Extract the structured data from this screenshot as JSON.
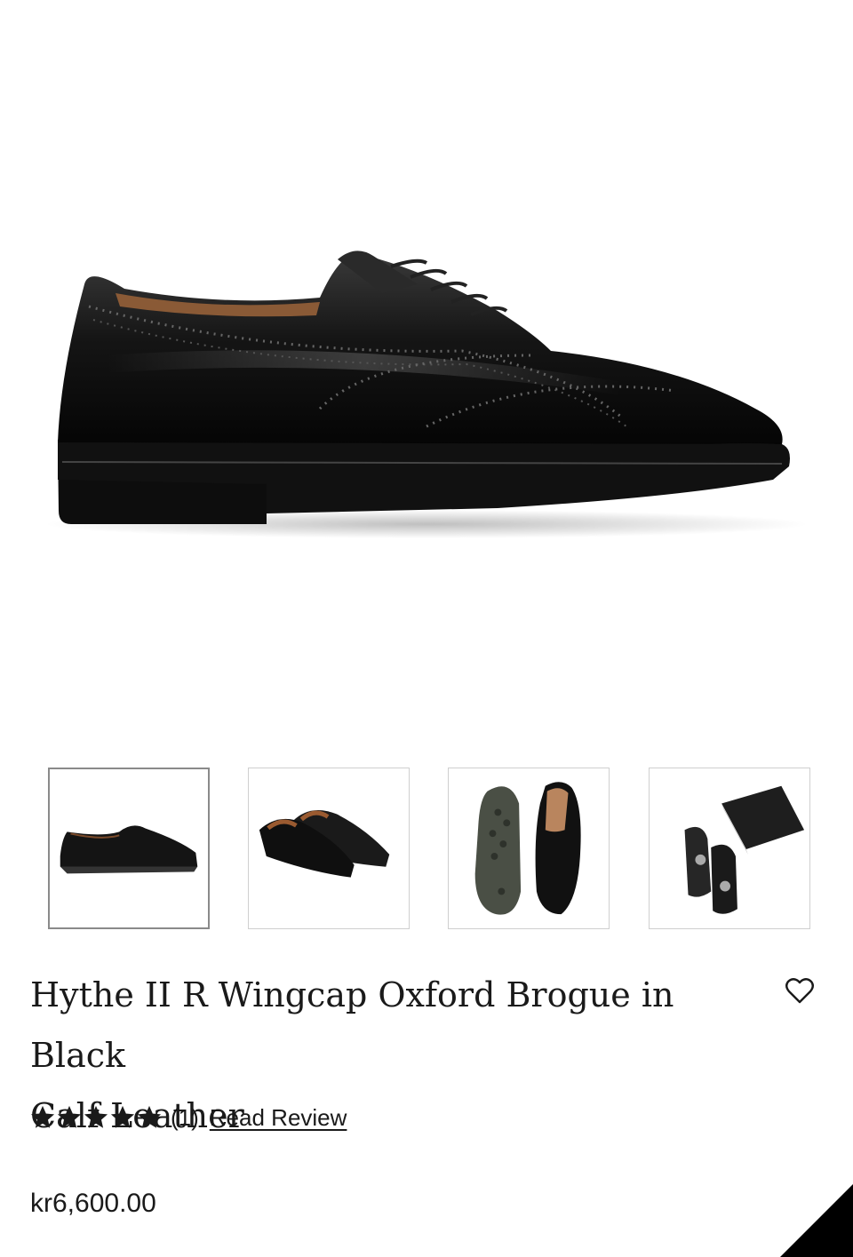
{
  "product": {
    "title_line1": "Hythe II R Wingcap Oxford Brogue in Black",
    "title_line2": "Calf Leather",
    "rating": 5,
    "rating_max": 5,
    "review_count": "(1)",
    "review_link_label": "Read Review",
    "price": "kr6,600.00"
  },
  "gallery": {
    "main_image": "black-oxford-brogue-side-view",
    "thumbnails": [
      {
        "image": "shoe-side-view",
        "selected": true
      },
      {
        "image": "shoe-pair-view",
        "selected": false
      },
      {
        "image": "sole-and-top-view",
        "selected": false
      },
      {
        "image": "shoe-bags-and-box",
        "selected": false
      }
    ]
  },
  "icons": {
    "wishlist": "heart-outline-icon",
    "star": "star-filled-icon"
  },
  "colors": {
    "text": "#1a1a1a",
    "thumb_border": "#cfcfcf",
    "active_thumb_border": "#8a8a8a",
    "corner": "#000000"
  }
}
